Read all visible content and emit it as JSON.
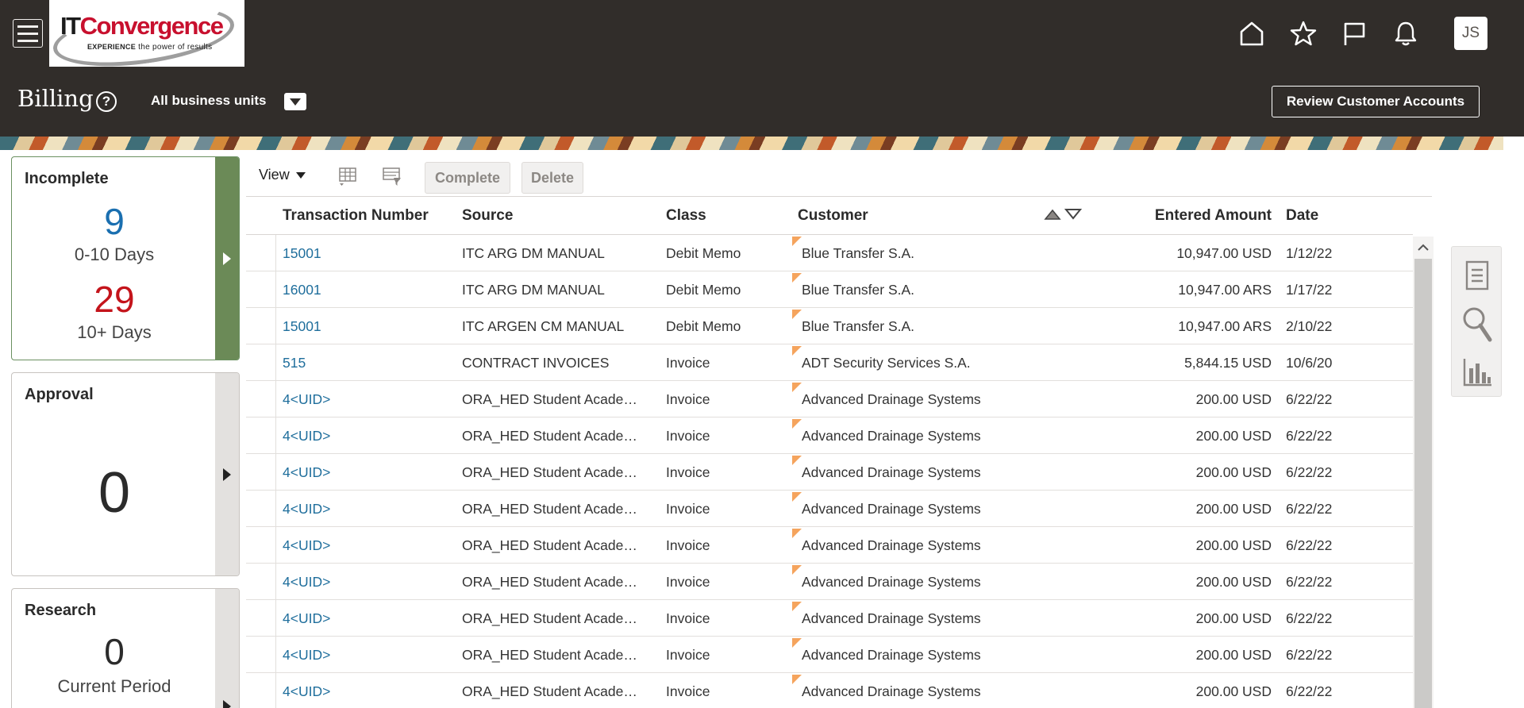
{
  "header": {
    "logo_brand_it": "IT",
    "logo_brand_rest": "Convergence",
    "logo_tagline_bold": "EXPERIENCE",
    "logo_tagline_rest": "the power of results",
    "user_initials": "JS"
  },
  "page": {
    "title": "Billing",
    "help_symbol": "?",
    "business_unit_label": "All business units",
    "review_button": "Review Customer Accounts"
  },
  "infolets": [
    {
      "title": "Incomplete",
      "count_1": "9",
      "label_1": "0-10 Days",
      "count_2": "29",
      "label_2": "10+ Days"
    },
    {
      "title": "Approval",
      "count_1": "0"
    },
    {
      "title": "Research",
      "count_1": "0",
      "label_1": "Current Period"
    }
  ],
  "toolbar": {
    "view_label": "View",
    "complete_label": "Complete",
    "delete_label": "Delete"
  },
  "table": {
    "columns": [
      "Transaction Number",
      "Source",
      "Class",
      "Customer",
      "Entered Amount",
      "Date"
    ],
    "rows": [
      {
        "txn": "15001",
        "source": "ITC ARG DM MANUAL",
        "class": "Debit Memo",
        "customer": "Blue Transfer S.A.",
        "amount": "10,947.00 USD",
        "date": "1/12/22"
      },
      {
        "txn": "16001",
        "source": "ITC ARG DM MANUAL",
        "class": "Debit Memo",
        "customer": "Blue Transfer S.A.",
        "amount": "10,947.00 ARS",
        "date": "1/17/22"
      },
      {
        "txn": "15001",
        "source": "ITC ARGEN CM MANUAL",
        "class": "Debit Memo",
        "customer": "Blue Transfer S.A.",
        "amount": "10,947.00 ARS",
        "date": "2/10/22"
      },
      {
        "txn": "515",
        "source": "CONTRACT INVOICES",
        "class": "Invoice",
        "customer": "ADT Security Services S.A.",
        "amount": "5,844.15 USD",
        "date": "10/6/20"
      },
      {
        "txn": "4<UID>",
        "source": "ORA_HED Student Academic",
        "class": "Invoice",
        "customer": "Advanced Drainage Systems",
        "amount": "200.00 USD",
        "date": "6/22/22"
      },
      {
        "txn": "4<UID>",
        "source": "ORA_HED Student Academic",
        "class": "Invoice",
        "customer": "Advanced Drainage Systems",
        "amount": "200.00 USD",
        "date": "6/22/22"
      },
      {
        "txn": "4<UID>",
        "source": "ORA_HED Student Academic",
        "class": "Invoice",
        "customer": "Advanced Drainage Systems",
        "amount": "200.00 USD",
        "date": "6/22/22"
      },
      {
        "txn": "4<UID>",
        "source": "ORA_HED Student Academic",
        "class": "Invoice",
        "customer": "Advanced Drainage Systems",
        "amount": "200.00 USD",
        "date": "6/22/22"
      },
      {
        "txn": "4<UID>",
        "source": "ORA_HED Student Academic",
        "class": "Invoice",
        "customer": "Advanced Drainage Systems",
        "amount": "200.00 USD",
        "date": "6/22/22"
      },
      {
        "txn": "4<UID>",
        "source": "ORA_HED Student Academic",
        "class": "Invoice",
        "customer": "Advanced Drainage Systems",
        "amount": "200.00 USD",
        "date": "6/22/22"
      },
      {
        "txn": "4<UID>",
        "source": "ORA_HED Student Academic",
        "class": "Invoice",
        "customer": "Advanced Drainage Systems",
        "amount": "200.00 USD",
        "date": "6/22/22"
      },
      {
        "txn": "4<UID>",
        "source": "ORA_HED Student Academic",
        "class": "Invoice",
        "customer": "Advanced Drainage Systems",
        "amount": "200.00 USD",
        "date": "6/22/22"
      },
      {
        "txn": "4<UID>",
        "source": "ORA_HED Student Academic",
        "class": "Invoice",
        "customer": "Advanced Drainage Systems",
        "amount": "200.00 USD",
        "date": "6/22/22"
      }
    ]
  },
  "colors": {
    "header_bg": "#312d2a",
    "link_blue": "#1f6e9c",
    "count_blue": "#1a6fb0",
    "count_red": "#c4141b",
    "active_strip": "#6b8a57",
    "flag_orange": "#f5a45d"
  },
  "icons": [
    "hamburger-icon",
    "home-icon",
    "star-icon",
    "flag-icon",
    "bell-icon",
    "help-icon",
    "dropdown-arrow-icon",
    "freeze-columns-icon",
    "detach-table-icon",
    "sort-ascending-icon",
    "sort-descending-icon",
    "chevron-right-icon",
    "scroll-up-icon",
    "document-icon",
    "search-icon",
    "bar-chart-icon"
  ]
}
